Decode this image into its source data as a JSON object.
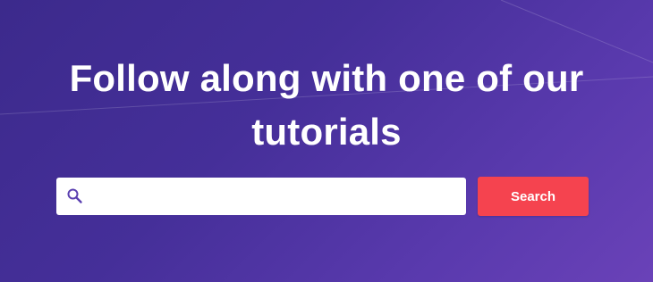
{
  "hero": {
    "title": "Follow along with one of our tutorials"
  },
  "search": {
    "value": "",
    "placeholder": "",
    "button_label": "Search",
    "icon": "search-icon"
  },
  "colors": {
    "background_start": "#3c2a8c",
    "background_end": "#6a42b8",
    "button": "#f5434f",
    "icon": "#5a3fb0"
  }
}
